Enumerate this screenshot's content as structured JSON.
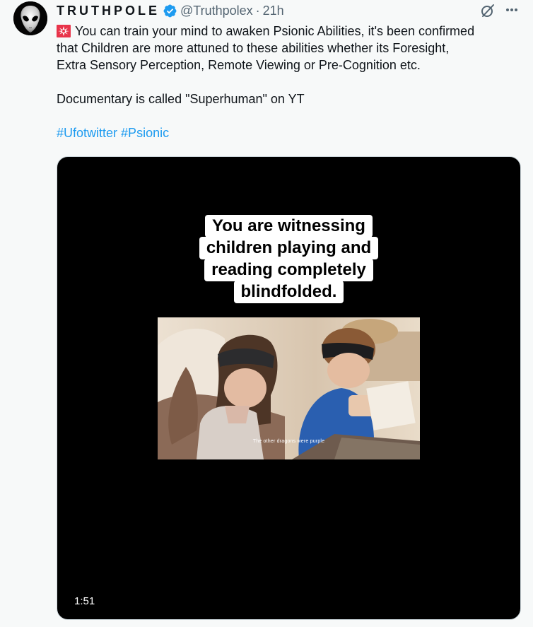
{
  "tweet": {
    "display_name": "TRUTHPOLE",
    "handle": "@Truthpolex",
    "separator": "·",
    "time": "21h",
    "text_lines": [
      "You can train your mind to awaken Psionic Abilities, it's been confirmed",
      "that Children are more attuned to these abilities whether its Foresight,",
      "Extra Sensory Perception, Remote Viewing or Pre-Cognition etc."
    ],
    "paragraph2": "Documentary is called \"Superhuman\"  on YT",
    "hashtags": [
      "#Ufotwitter",
      "#Psionic"
    ],
    "icons": {
      "avatar": "alien-avatar",
      "verified": "verified-badge-icon",
      "grok": "grok-icon",
      "more": "more-icon",
      "emoji": "siren-emoji-icon"
    },
    "accent_color": "#1d9bf0"
  },
  "video": {
    "caption_lines": [
      "You are witnessing",
      "children playing and",
      "reading completely",
      "blindfolded."
    ],
    "subtitle": "The other dragons were purple",
    "duration": "1:51"
  }
}
